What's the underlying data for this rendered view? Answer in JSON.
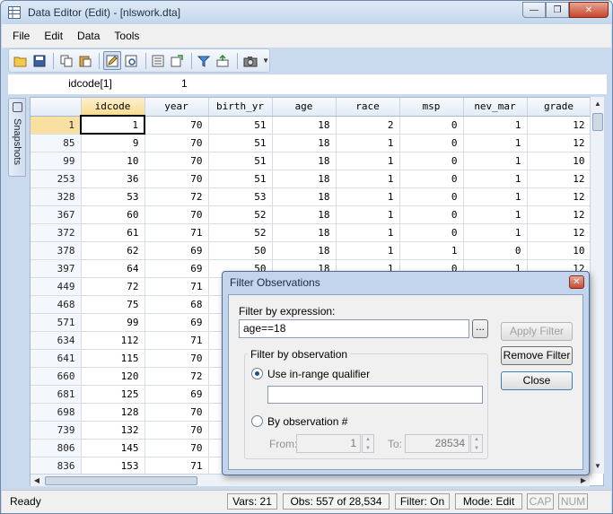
{
  "window": {
    "title": "Data Editor (Edit) - [nlswork.dta]"
  },
  "menu": [
    "File",
    "Edit",
    "Data",
    "Tools"
  ],
  "cellbar": {
    "name": "idcode[1]",
    "value": "1"
  },
  "snapshots_label": "Snapshots",
  "grid": {
    "columns": [
      "idcode",
      "year",
      "birth_yr",
      "age",
      "race",
      "msp",
      "nev_mar",
      "grade"
    ],
    "rows": [
      [
        "1",
        "1",
        "70",
        "51",
        "18",
        "2",
        "0",
        "1",
        "12"
      ],
      [
        "85",
        "9",
        "70",
        "51",
        "18",
        "1",
        "0",
        "1",
        "12"
      ],
      [
        "99",
        "10",
        "70",
        "51",
        "18",
        "1",
        "0",
        "1",
        "10"
      ],
      [
        "253",
        "36",
        "70",
        "51",
        "18",
        "1",
        "0",
        "1",
        "12"
      ],
      [
        "328",
        "53",
        "72",
        "53",
        "18",
        "1",
        "0",
        "1",
        "12"
      ],
      [
        "367",
        "60",
        "70",
        "52",
        "18",
        "1",
        "0",
        "1",
        "12"
      ],
      [
        "372",
        "61",
        "71",
        "52",
        "18",
        "1",
        "0",
        "1",
        "12"
      ],
      [
        "378",
        "62",
        "69",
        "50",
        "18",
        "1",
        "1",
        "0",
        "10"
      ],
      [
        "397",
        "64",
        "69",
        "50",
        "18",
        "1",
        "0",
        "1",
        "12"
      ],
      [
        "449",
        "72",
        "71",
        "",
        "",
        "",
        "",
        "",
        ""
      ],
      [
        "468",
        "75",
        "68",
        "",
        "",
        "",
        "",
        "",
        ""
      ],
      [
        "571",
        "99",
        "69",
        "",
        "",
        "",
        "",
        "",
        ""
      ],
      [
        "634",
        "112",
        "71",
        "",
        "",
        "",
        "",
        "",
        ""
      ],
      [
        "641",
        "115",
        "70",
        "",
        "",
        "",
        "",
        "",
        ""
      ],
      [
        "660",
        "120",
        "72",
        "",
        "",
        "",
        "",
        "",
        ""
      ],
      [
        "681",
        "125",
        "69",
        "",
        "",
        "",
        "",
        "",
        ""
      ],
      [
        "698",
        "128",
        "70",
        "",
        "",
        "",
        "",
        "",
        ""
      ],
      [
        "739",
        "132",
        "70",
        "",
        "",
        "",
        "",
        "",
        ""
      ],
      [
        "806",
        "145",
        "70",
        "",
        "",
        "",
        "",
        "",
        ""
      ],
      [
        "836",
        "153",
        "71",
        "",
        "",
        "",
        "",
        "",
        ""
      ]
    ]
  },
  "status": {
    "ready": "Ready",
    "vars": "Vars: 21",
    "obs": "Obs: 557 of 28,534",
    "filter": "Filter: On",
    "mode": "Mode: Edit",
    "cap": "CAP",
    "num": "NUM"
  },
  "dialog": {
    "title": "Filter Observations",
    "expr_label": "Filter by expression:",
    "expr_value": "age==18",
    "browse_label": "...",
    "apply_label": "Apply Filter",
    "remove_label": "Remove Filter",
    "close_label": "Close",
    "obs_group_label": "Filter by observation",
    "inrange_label": "Use in-range qualifier",
    "inrange_value": "",
    "byobs_label": "By observation #",
    "from_label": "From:",
    "from_value": "1",
    "to_label": "To:",
    "to_value": "28534"
  }
}
